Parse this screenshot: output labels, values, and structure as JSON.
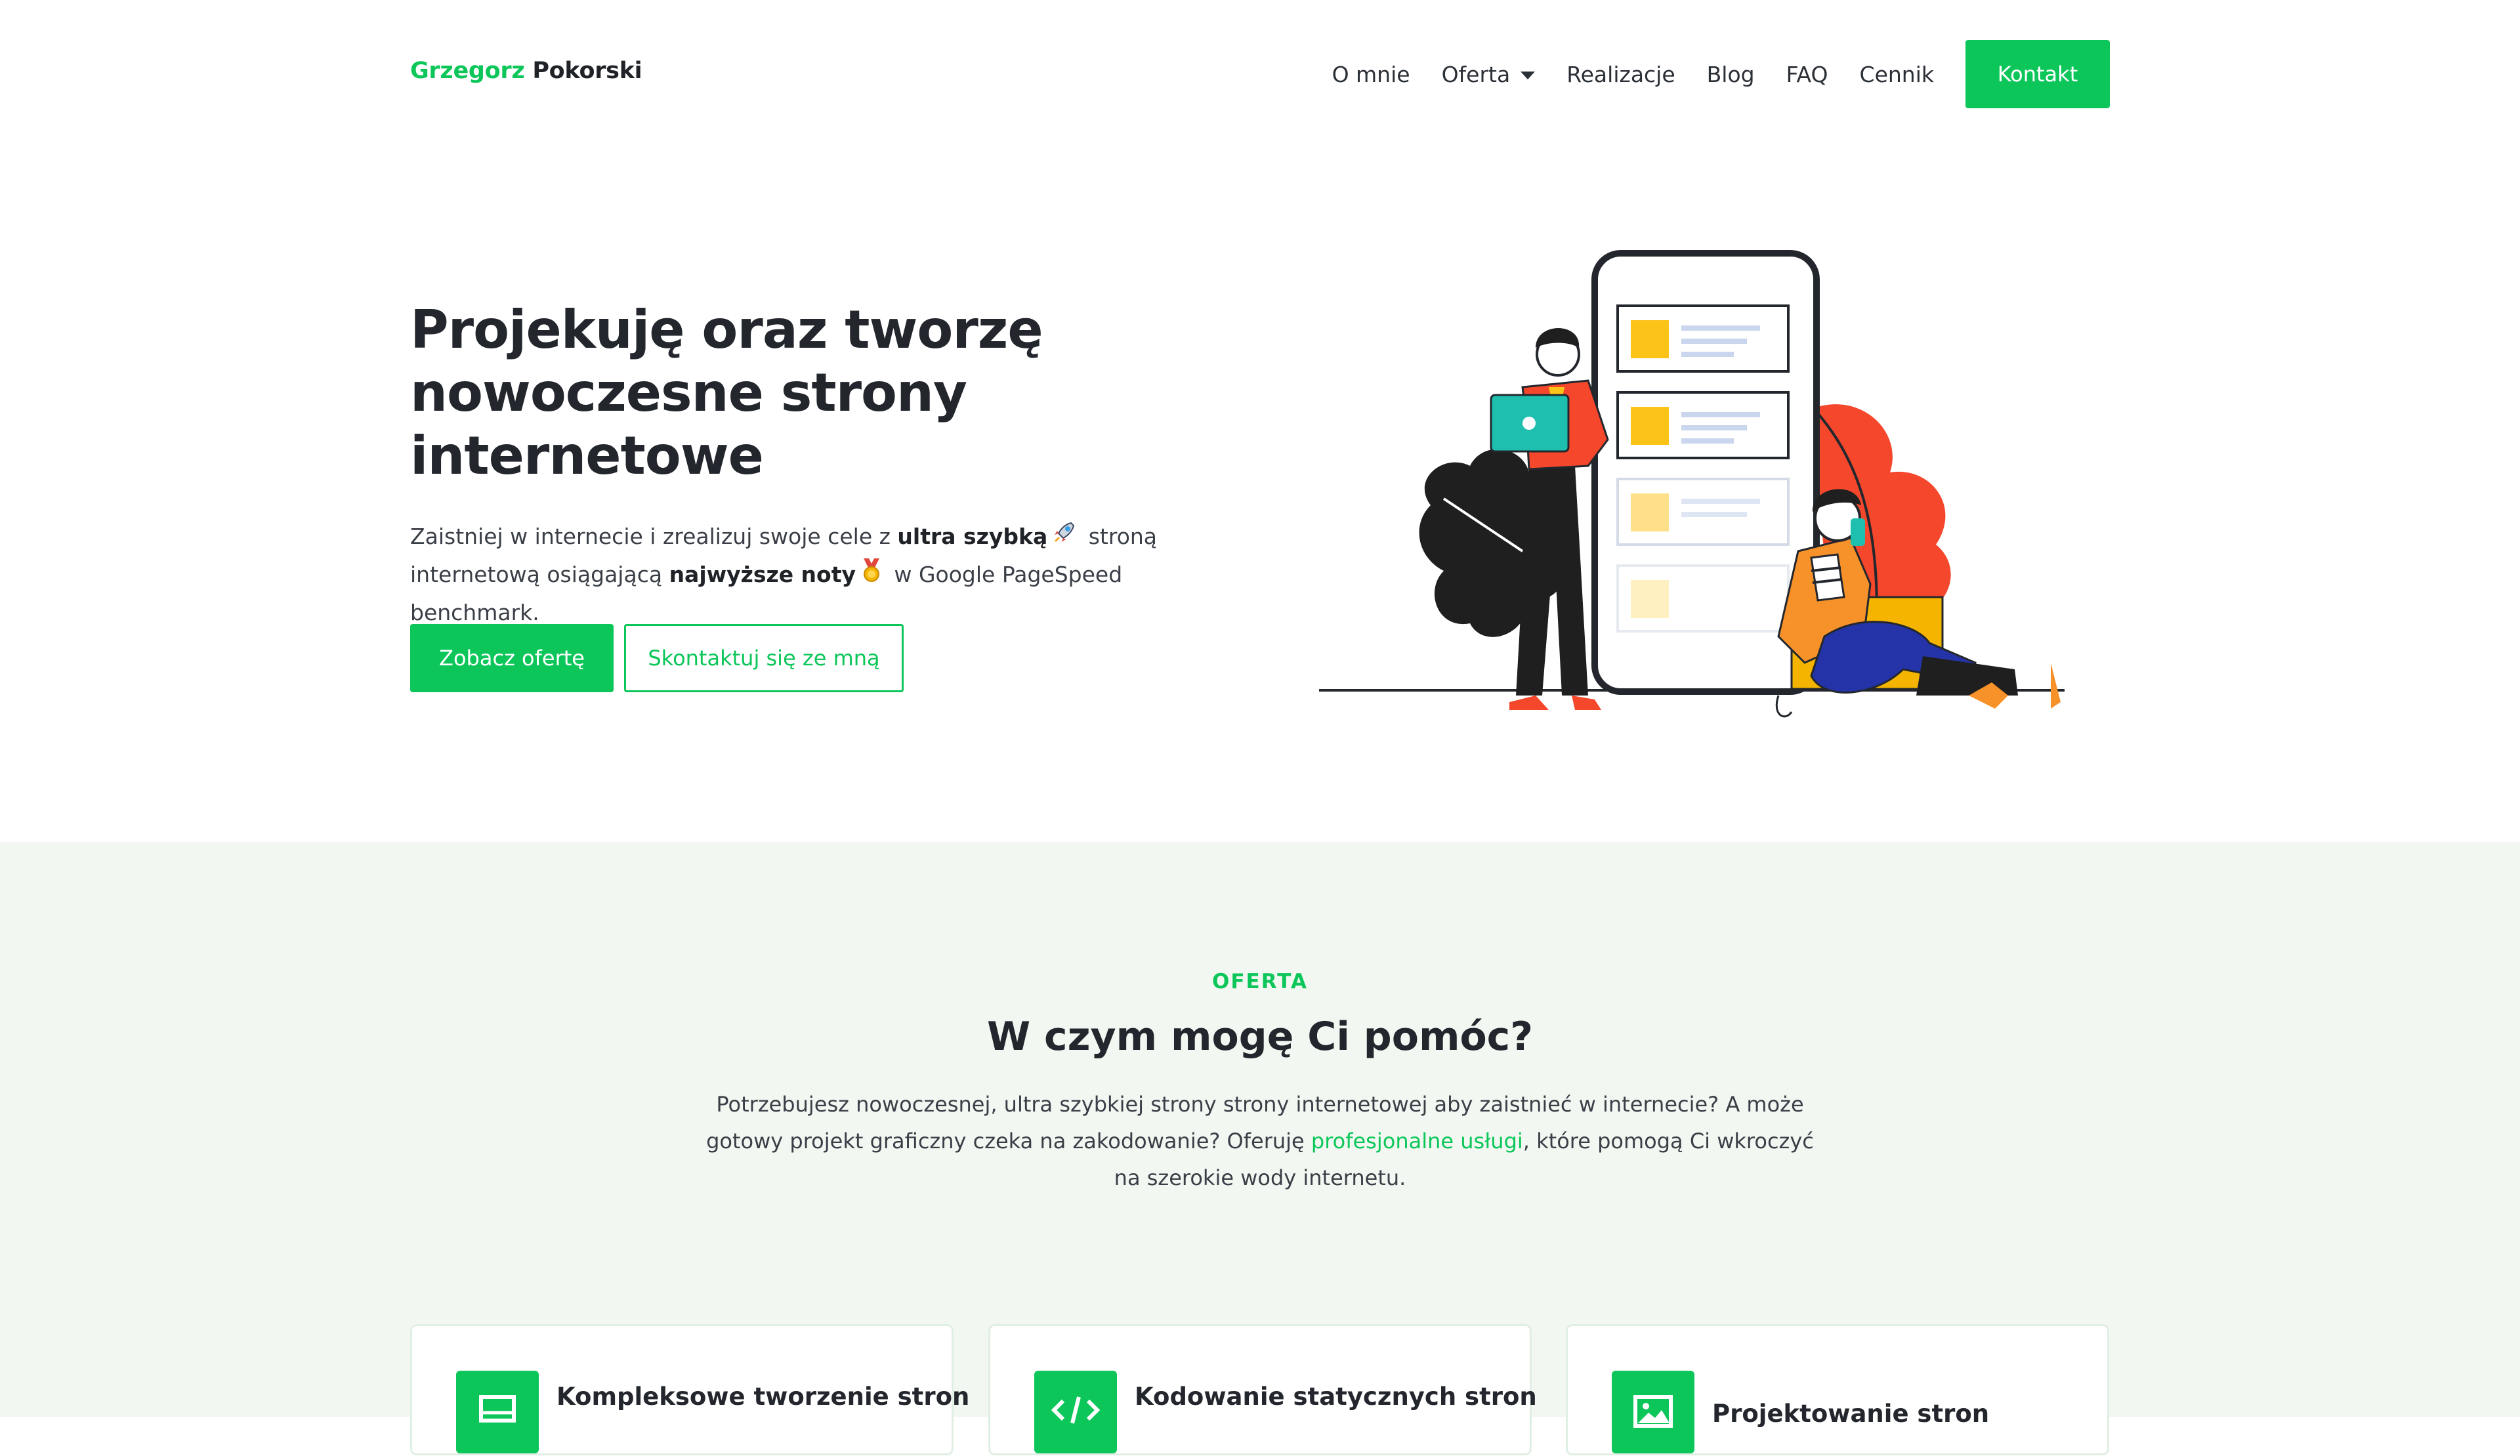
{
  "header": {
    "logo_first": "Grzegorz",
    "logo_last": "Pokorski",
    "nav": [
      {
        "label": "O mnie"
      },
      {
        "label": "Oferta",
        "has_dropdown": true
      },
      {
        "label": "Realizacje"
      },
      {
        "label": "Blog"
      },
      {
        "label": "FAQ"
      },
      {
        "label": "Cennik"
      }
    ],
    "cta_label": "Kontakt"
  },
  "hero": {
    "title": "Projekuję oraz tworzę nowoczesne strony internetowe",
    "sub_part1": "Zaistniej w internecie i zrealizuj swoje cele z ",
    "sub_bold1": "ultra szybką",
    "sub_emoji1": "rocket-icon",
    "sub_part2": " stroną internetową osiągającą ",
    "sub_bold2": "najwyższe noty",
    "sub_emoji2": "medal-icon",
    "sub_part3": " w Google PageSpeed benchmark.",
    "primary_button": "Zobacz ofertę",
    "secondary_button": "Skontaktuj się ze mną"
  },
  "offer": {
    "eyebrow": "OFERTA",
    "title": "W czym mogę Ci pomóc?",
    "desc_part1": "Potrzebujesz nowoczesnej, ultra szybkiej strony strony internetowej aby zaistnieć w internecie? A może gotowy projekt graficzny czeka na zakodowanie? Oferuję ",
    "desc_link": "profesjonalne usługi",
    "desc_part2": ", które pomogą Ci wkroczyć na szerokie wody internetu.",
    "cards": [
      {
        "title": "Kompleksowe tworzenie stron",
        "icon": "monitor-icon"
      },
      {
        "title": "Kodowanie statycznych stron",
        "icon": "code-icon"
      },
      {
        "title": "Projektowanie stron",
        "icon": "image-icon"
      }
    ]
  },
  "colors": {
    "accent": "#0cc65a",
    "section_bg": "#f2f8f1",
    "text": "#23272d"
  }
}
